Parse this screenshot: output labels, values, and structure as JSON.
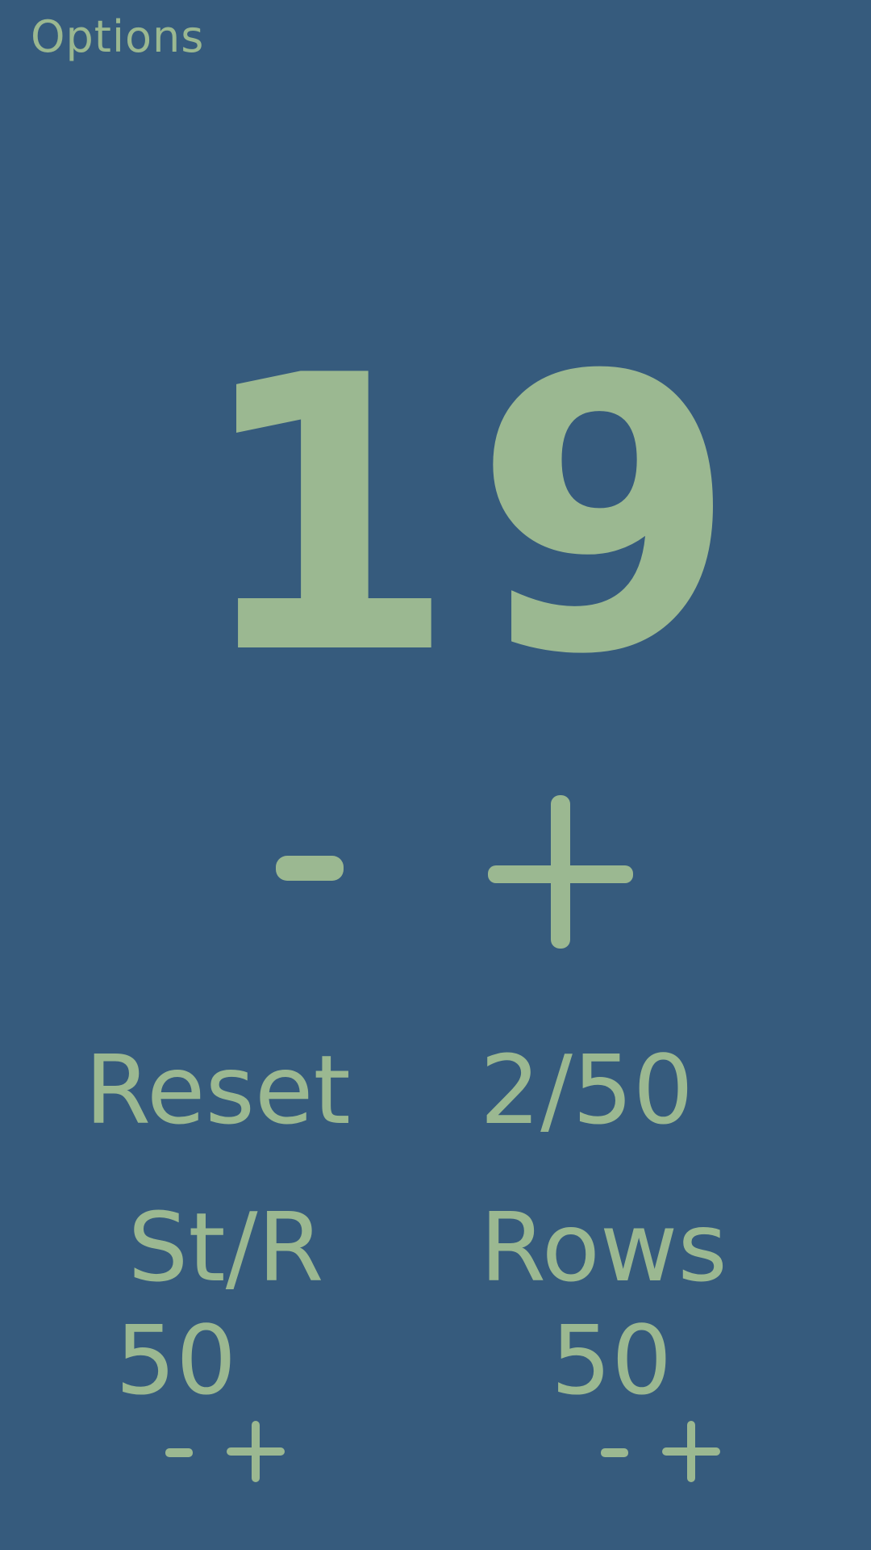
{
  "header": {
    "options_label": "Options"
  },
  "counter": {
    "value": "19"
  },
  "main_controls": {
    "minus_icon": "minus-icon",
    "plus_icon": "plus-icon"
  },
  "footer": {
    "reset_label": "Reset",
    "progress": "2/50"
  },
  "stitches": {
    "label": "St/R",
    "value": "50"
  },
  "rows": {
    "label": "Rows",
    "value": "50"
  },
  "colors": {
    "background": "#365b7d",
    "foreground": "#9bb891"
  }
}
